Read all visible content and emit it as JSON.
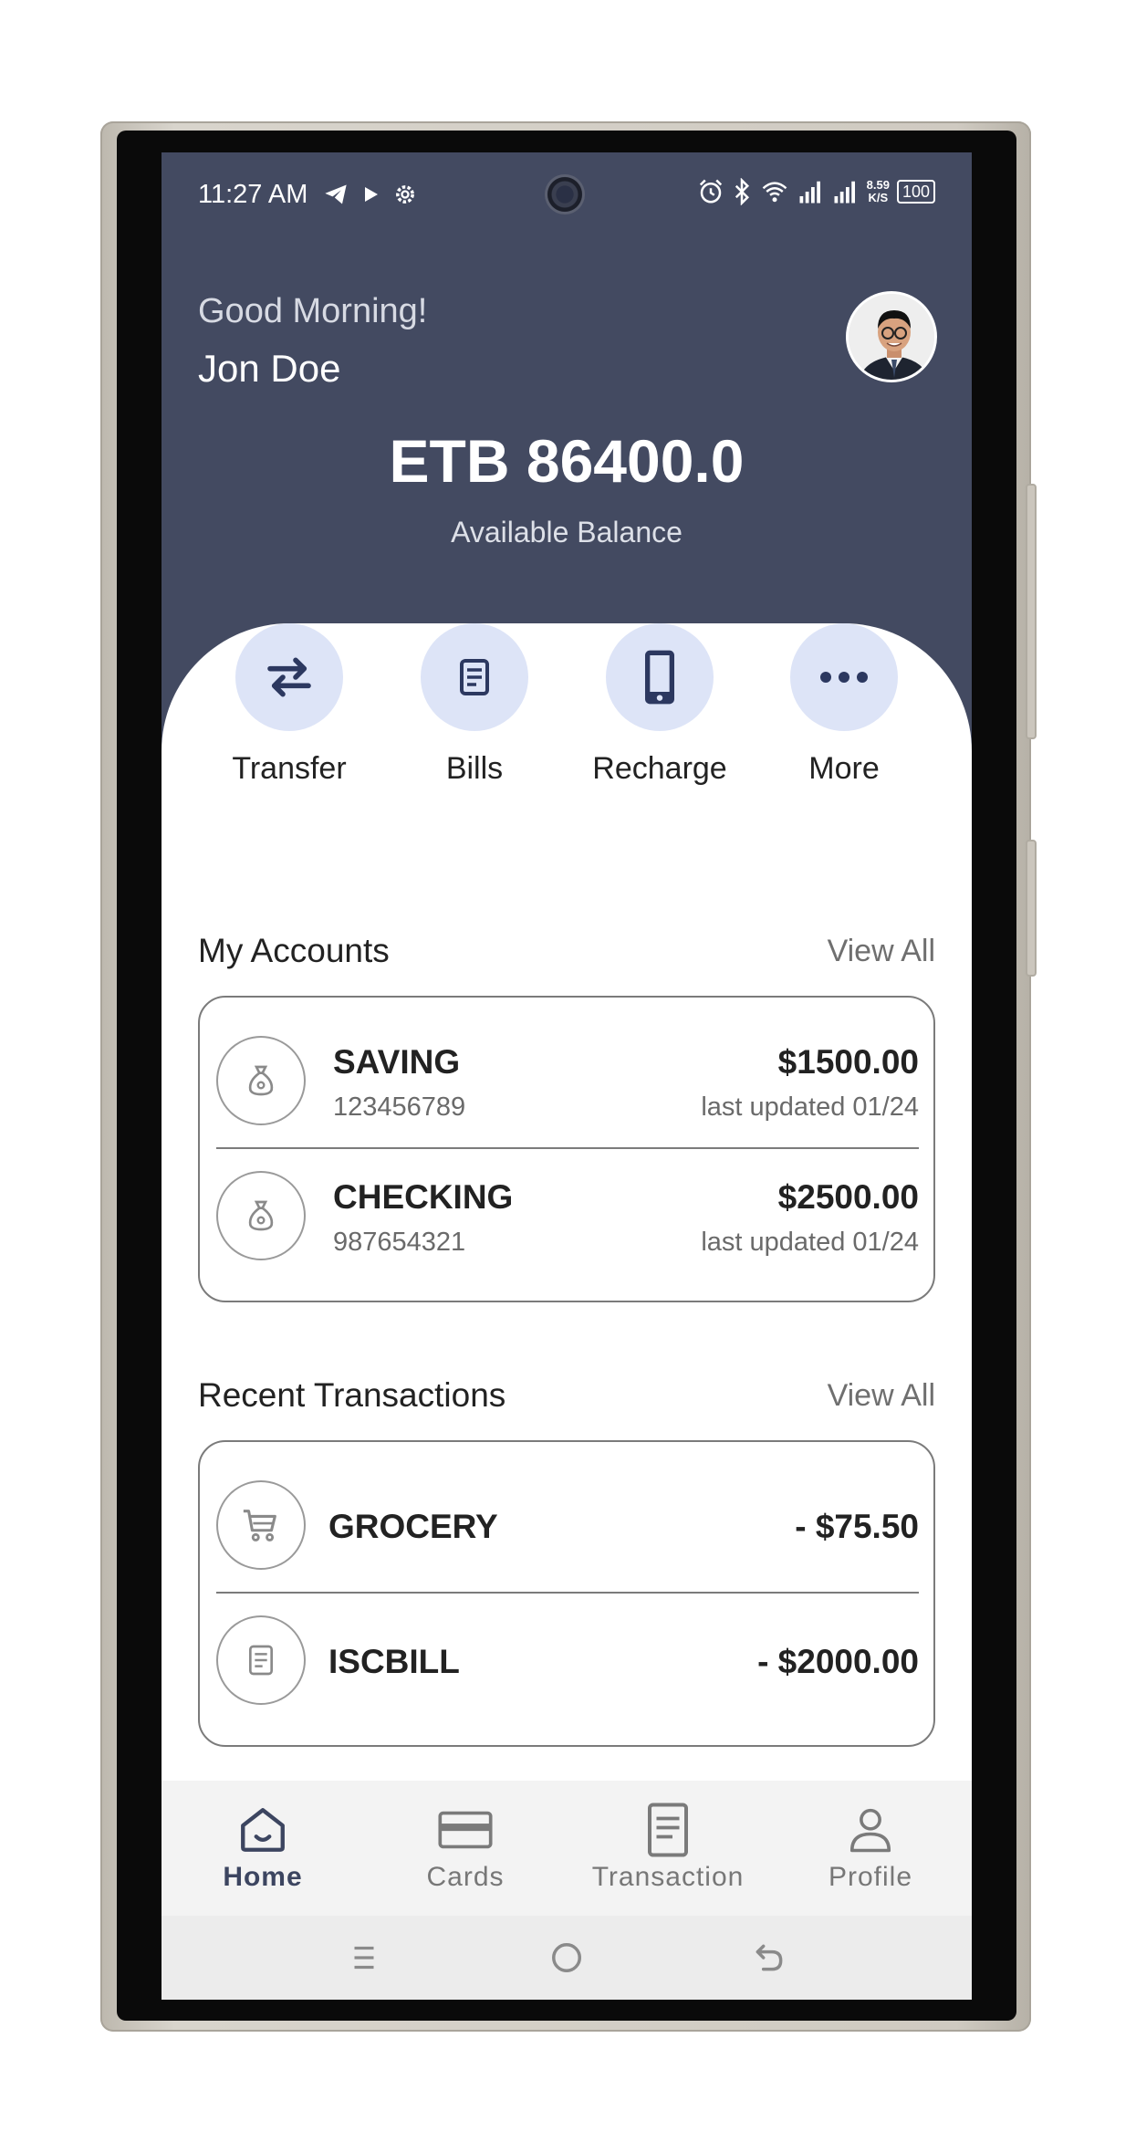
{
  "status_bar": {
    "time": "11:27 AM",
    "net_speed": "8.59",
    "net_unit": "K/S",
    "battery": "100"
  },
  "header": {
    "greeting": "Good Morning!",
    "user_name": "Jon Doe",
    "balance": "ETB 86400.0",
    "balance_label": "Available Balance"
  },
  "quick_actions": [
    {
      "label": "Transfer",
      "icon": "transfer-icon"
    },
    {
      "label": "Bills",
      "icon": "bill-icon"
    },
    {
      "label": "Recharge",
      "icon": "phone-icon"
    },
    {
      "label": "More",
      "icon": "more-icon"
    }
  ],
  "accounts": {
    "title": "My Accounts",
    "view_all": "View All",
    "items": [
      {
        "name": "SAVING",
        "number": "123456789",
        "amount": "$1500.00",
        "updated": "last updated 01/24"
      },
      {
        "name": "CHECKING",
        "number": "987654321",
        "amount": "$2500.00",
        "updated": "last updated 01/24"
      }
    ]
  },
  "transactions": {
    "title": "Recent Transactions",
    "view_all": "View All",
    "items": [
      {
        "name": "GROCERY",
        "amount": "- $75.50",
        "icon": "cart-icon"
      },
      {
        "name": "ISCBILL",
        "amount": "- $2000.00",
        "icon": "bill-icon"
      }
    ]
  },
  "bottom_nav": [
    {
      "label": "Home",
      "active": true
    },
    {
      "label": "Cards",
      "active": false
    },
    {
      "label": "Transaction",
      "active": false
    },
    {
      "label": "Profile",
      "active": false
    }
  ],
  "colors": {
    "header_bg": "#434a61",
    "action_bg": "#dde4f7",
    "action_icon": "#2c3860",
    "nav_active": "#3c4560"
  }
}
